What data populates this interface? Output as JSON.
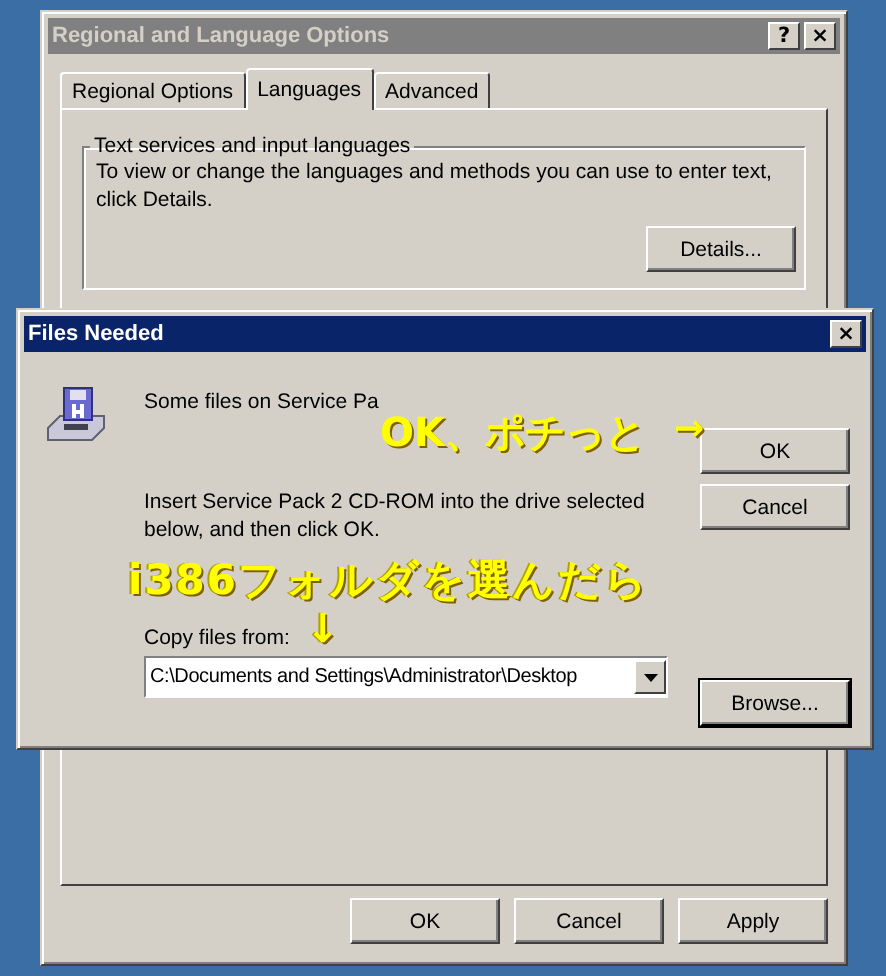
{
  "back_window": {
    "title": "Regional and Language Options",
    "help_button": "?",
    "close_button": "×",
    "tabs": [
      {
        "label": "Regional Options",
        "selected": false
      },
      {
        "label": "Languages",
        "selected": true
      },
      {
        "label": "Advanced",
        "selected": false
      }
    ],
    "group": {
      "legend": "Text services and input languages",
      "description": "To view or change the languages and methods you can use to enter text, click Details.",
      "button": "Details..."
    },
    "buttons": [
      "OK",
      "Cancel",
      "Apply"
    ]
  },
  "front_window": {
    "title": "Files Needed",
    "close_button": "×",
    "message": "Some files on Service Pa",
    "ok_button": "OK",
    "cancel_button": "Cancel",
    "instruction": "Insert Service Pack 2 CD-ROM into the drive selected below, and then click OK.",
    "copy_label": "Copy files from:",
    "copy_value": "C:\\Documents and Settings\\Administrator\\Desktop",
    "browse_button": "Browse..."
  },
  "annotations": [
    {
      "text": "OK、ポチっと",
      "arrow": "→"
    },
    {
      "text": "i386フォルダを選んだら",
      "arrow": "↓"
    }
  ]
}
